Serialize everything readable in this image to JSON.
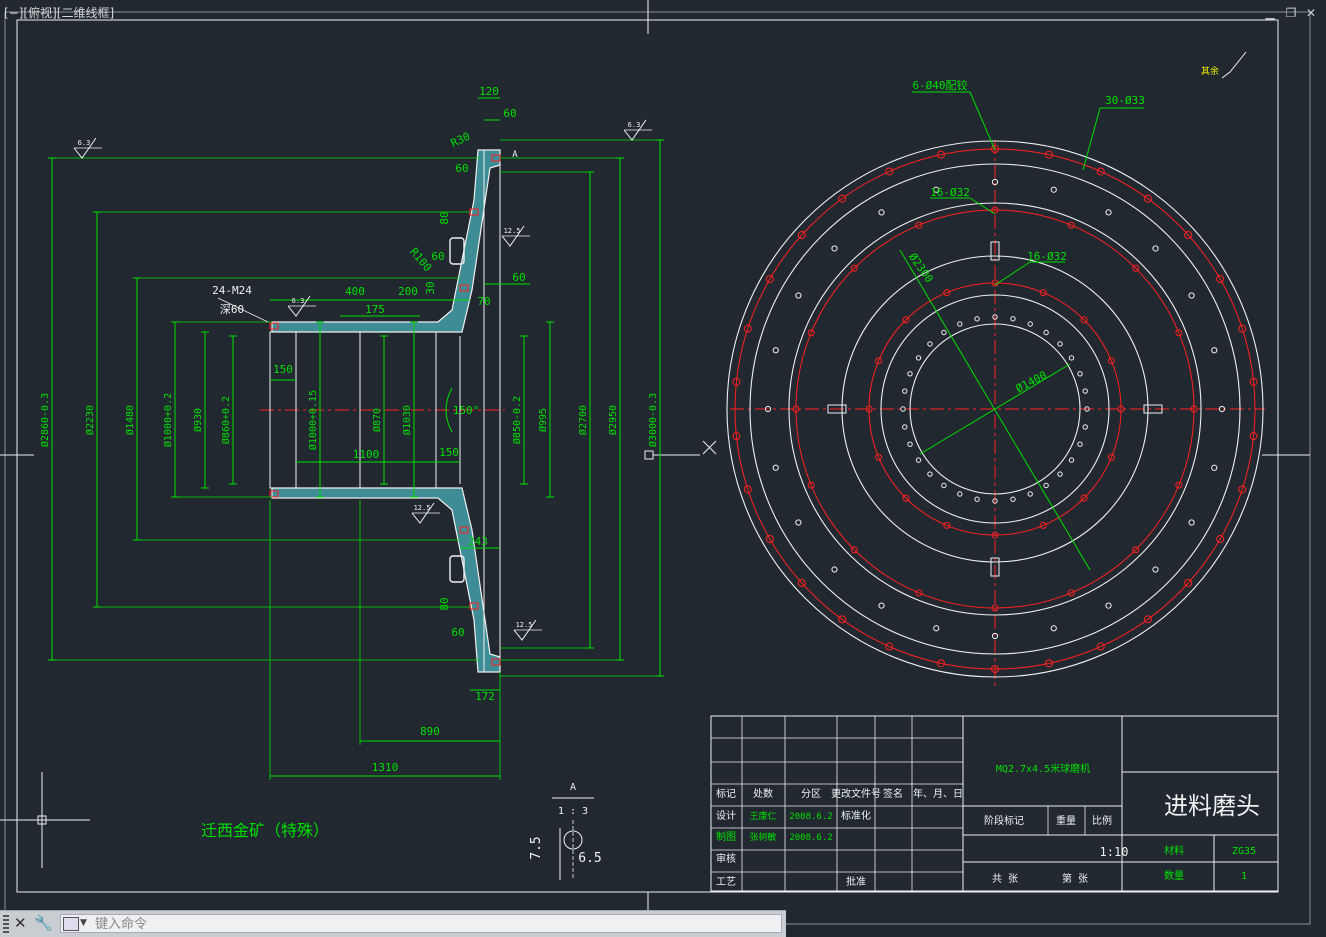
{
  "viewport": {
    "label": "[−][俯视][二维线框]"
  },
  "window_controls": {
    "minimize": "▁",
    "restore": "❐",
    "close": "✕"
  },
  "command_line": {
    "placeholder": "键入命令",
    "close_icon": "✕",
    "settings_icon": "🔧"
  },
  "colors": {
    "background": "#212830",
    "green": "#00e000",
    "white": "#f0f0f0",
    "red": "#ff2020",
    "cyan": "#2ab0c0",
    "yellow": "#f0f000"
  },
  "section_view": {
    "dims": {
      "d120": "120",
      "d60a": "60",
      "d60b": "60",
      "r30": "R30",
      "d60c": "60",
      "d80a": "80",
      "r100": "R100",
      "d60d": "60",
      "d30": "30",
      "d70": "70",
      "m24": "24-M24",
      "deep60": "深60",
      "d400": "400",
      "d200": "200",
      "d175": "175",
      "d150a": "150",
      "d1100": "1100",
      "d150b": "150",
      "a150": "150°",
      "d243": "243",
      "d80b": "80",
      "d60e": "60",
      "d172": "172",
      "d890": "890",
      "d1310": "1310",
      "v2860": "Ø2860-0.3",
      "v2230": "Ø2230",
      "v1480": "Ø1480",
      "v1000": "Ø1000+0.2",
      "v930": "Ø930",
      "v860": "Ø860+0.2",
      "v1000b": "Ø1000+0.15",
      "v870": "Ø870",
      "v1030": "Ø1030",
      "v850": "Ø850-0.2",
      "v995": "Ø995",
      "v2700": "Ø2700",
      "v2950": "Ø2950",
      "v3000": "Ø3000-0.3",
      "rough63": "6.3",
      "rough125": "12.5",
      "roughA": "A"
    }
  },
  "end_view": {
    "labels": {
      "pin": "6-Ø40配铰",
      "h30": "30-Ø33",
      "h16a": "16-Ø32",
      "h16b": "16-Ø32",
      "d2300": "Ø2300",
      "d1400": "Ø1400",
      "other": "其余"
    }
  },
  "detail": {
    "title": "A",
    "scale": "1 : 3",
    "dim1": "7.5",
    "dim2": "6.5"
  },
  "note": "迁西金矿（特殊）",
  "title_block": {
    "project": "MQ2.7x4.5米球磨机",
    "drawing_name": "进料磨头",
    "scale": "1:10",
    "scale_label": "比例",
    "weight_label": "重量",
    "stage_label": "阶段标记",
    "material_label": "材料",
    "material": "ZG35",
    "qty_label": "数量",
    "qty": "1",
    "sheets_label": "共 张",
    "sheet_label": "第 张",
    "head_row": [
      "标记",
      "处数",
      "分区",
      "更改文件号",
      "签名",
      "年、月、日"
    ],
    "design": "设计",
    "designer": "王康仁",
    "design_date": "2008.6.2",
    "standard": "标准化",
    "check": "制图",
    "checker": "张树敏",
    "check_date": "2008.6.2",
    "review": "审核",
    "process": "工艺",
    "approve": "批准"
  }
}
